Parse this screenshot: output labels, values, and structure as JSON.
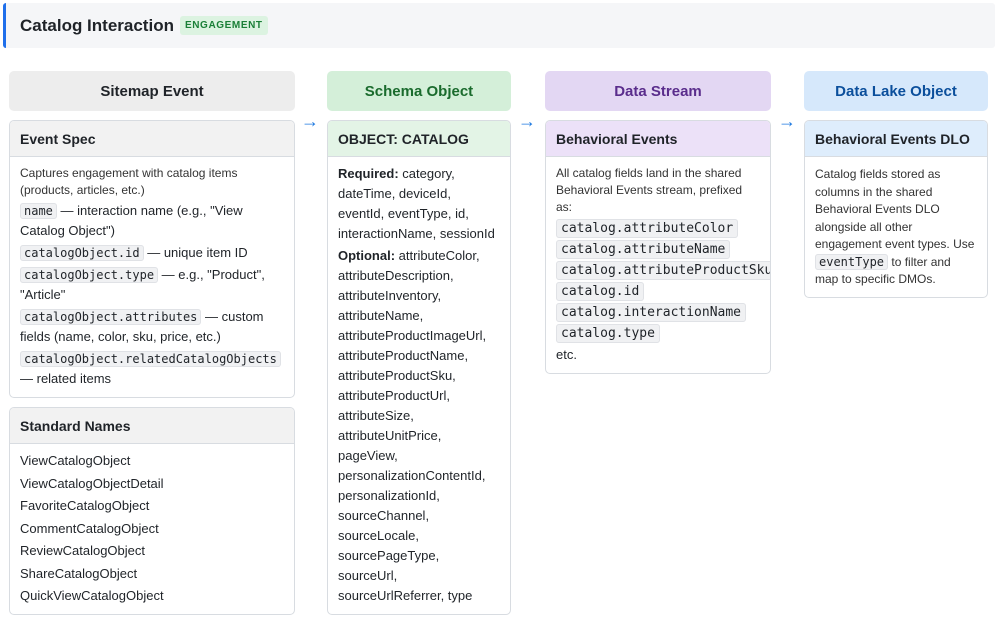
{
  "header": {
    "title": "Catalog Interaction",
    "badge": "ENGAGEMENT"
  },
  "columns": {
    "sitemap": {
      "title": "Sitemap Event",
      "event_spec": {
        "title": "Event Spec",
        "intro": "Captures engagement with catalog items (products, articles, etc.)",
        "items": [
          {
            "code": "name",
            "text": " — interaction name (e.g., \"View Catalog Object\")"
          },
          {
            "code": "catalogObject.id",
            "text": " — unique item ID"
          },
          {
            "code": "catalogObject.type",
            "text": " — e.g., \"Product\", \"Article\""
          },
          {
            "code": "catalogObject.attributes",
            "text": " — custom fields (name, color, sku, price, etc.)"
          },
          {
            "code": "catalogObject.relatedCatalogObjects",
            "text": " — related items"
          }
        ]
      },
      "standard_names": {
        "title": "Standard Names",
        "items": [
          "ViewCatalogObject",
          "ViewCatalogObjectDetail",
          "FavoriteCatalogObject",
          "CommentCatalogObject",
          "ReviewCatalogObject",
          "ShareCatalogObject",
          "QuickViewCatalogObject"
        ]
      }
    },
    "schema": {
      "title": "Schema Object",
      "card_title": "OBJECT: CATALOG",
      "required_label": "Required:",
      "required": " category, dateTime, deviceId, eventId, eventType, id, interactionName, sessionId",
      "optional_label": "Optional:",
      "optional": " attributeColor, attributeDescription, attributeInventory, attributeName, attributeProductImageUrl, attributeProductName, attributeProductSku, attributeProductUrl, attributeSize, attributeUnitPrice, pageView, personalizationContentId, personalizationId, sourceChannel, sourceLocale, sourcePageType, sourceUrl, sourceUrlReferrer, type"
    },
    "stream": {
      "title": "Data Stream",
      "card_title": "Behavioral Events",
      "intro": "All catalog fields land in the shared Behavioral Events stream, prefixed as:",
      "fields": [
        "catalog.attributeColor",
        "catalog.attributeName",
        "catalog.attributeProductSku",
        "catalog.id",
        "catalog.interactionName",
        "catalog.type"
      ],
      "etc": "etc."
    },
    "dlo": {
      "title": "Data Lake Object",
      "card_title": "Behavioral Events DLO",
      "text_before": "Catalog fields stored as columns in the shared Behavioral Events DLO alongside all other engagement event types. Use ",
      "code": "eventType",
      "text_after": " to filter and map to specific DMOs."
    }
  },
  "arrow_glyph": "→"
}
